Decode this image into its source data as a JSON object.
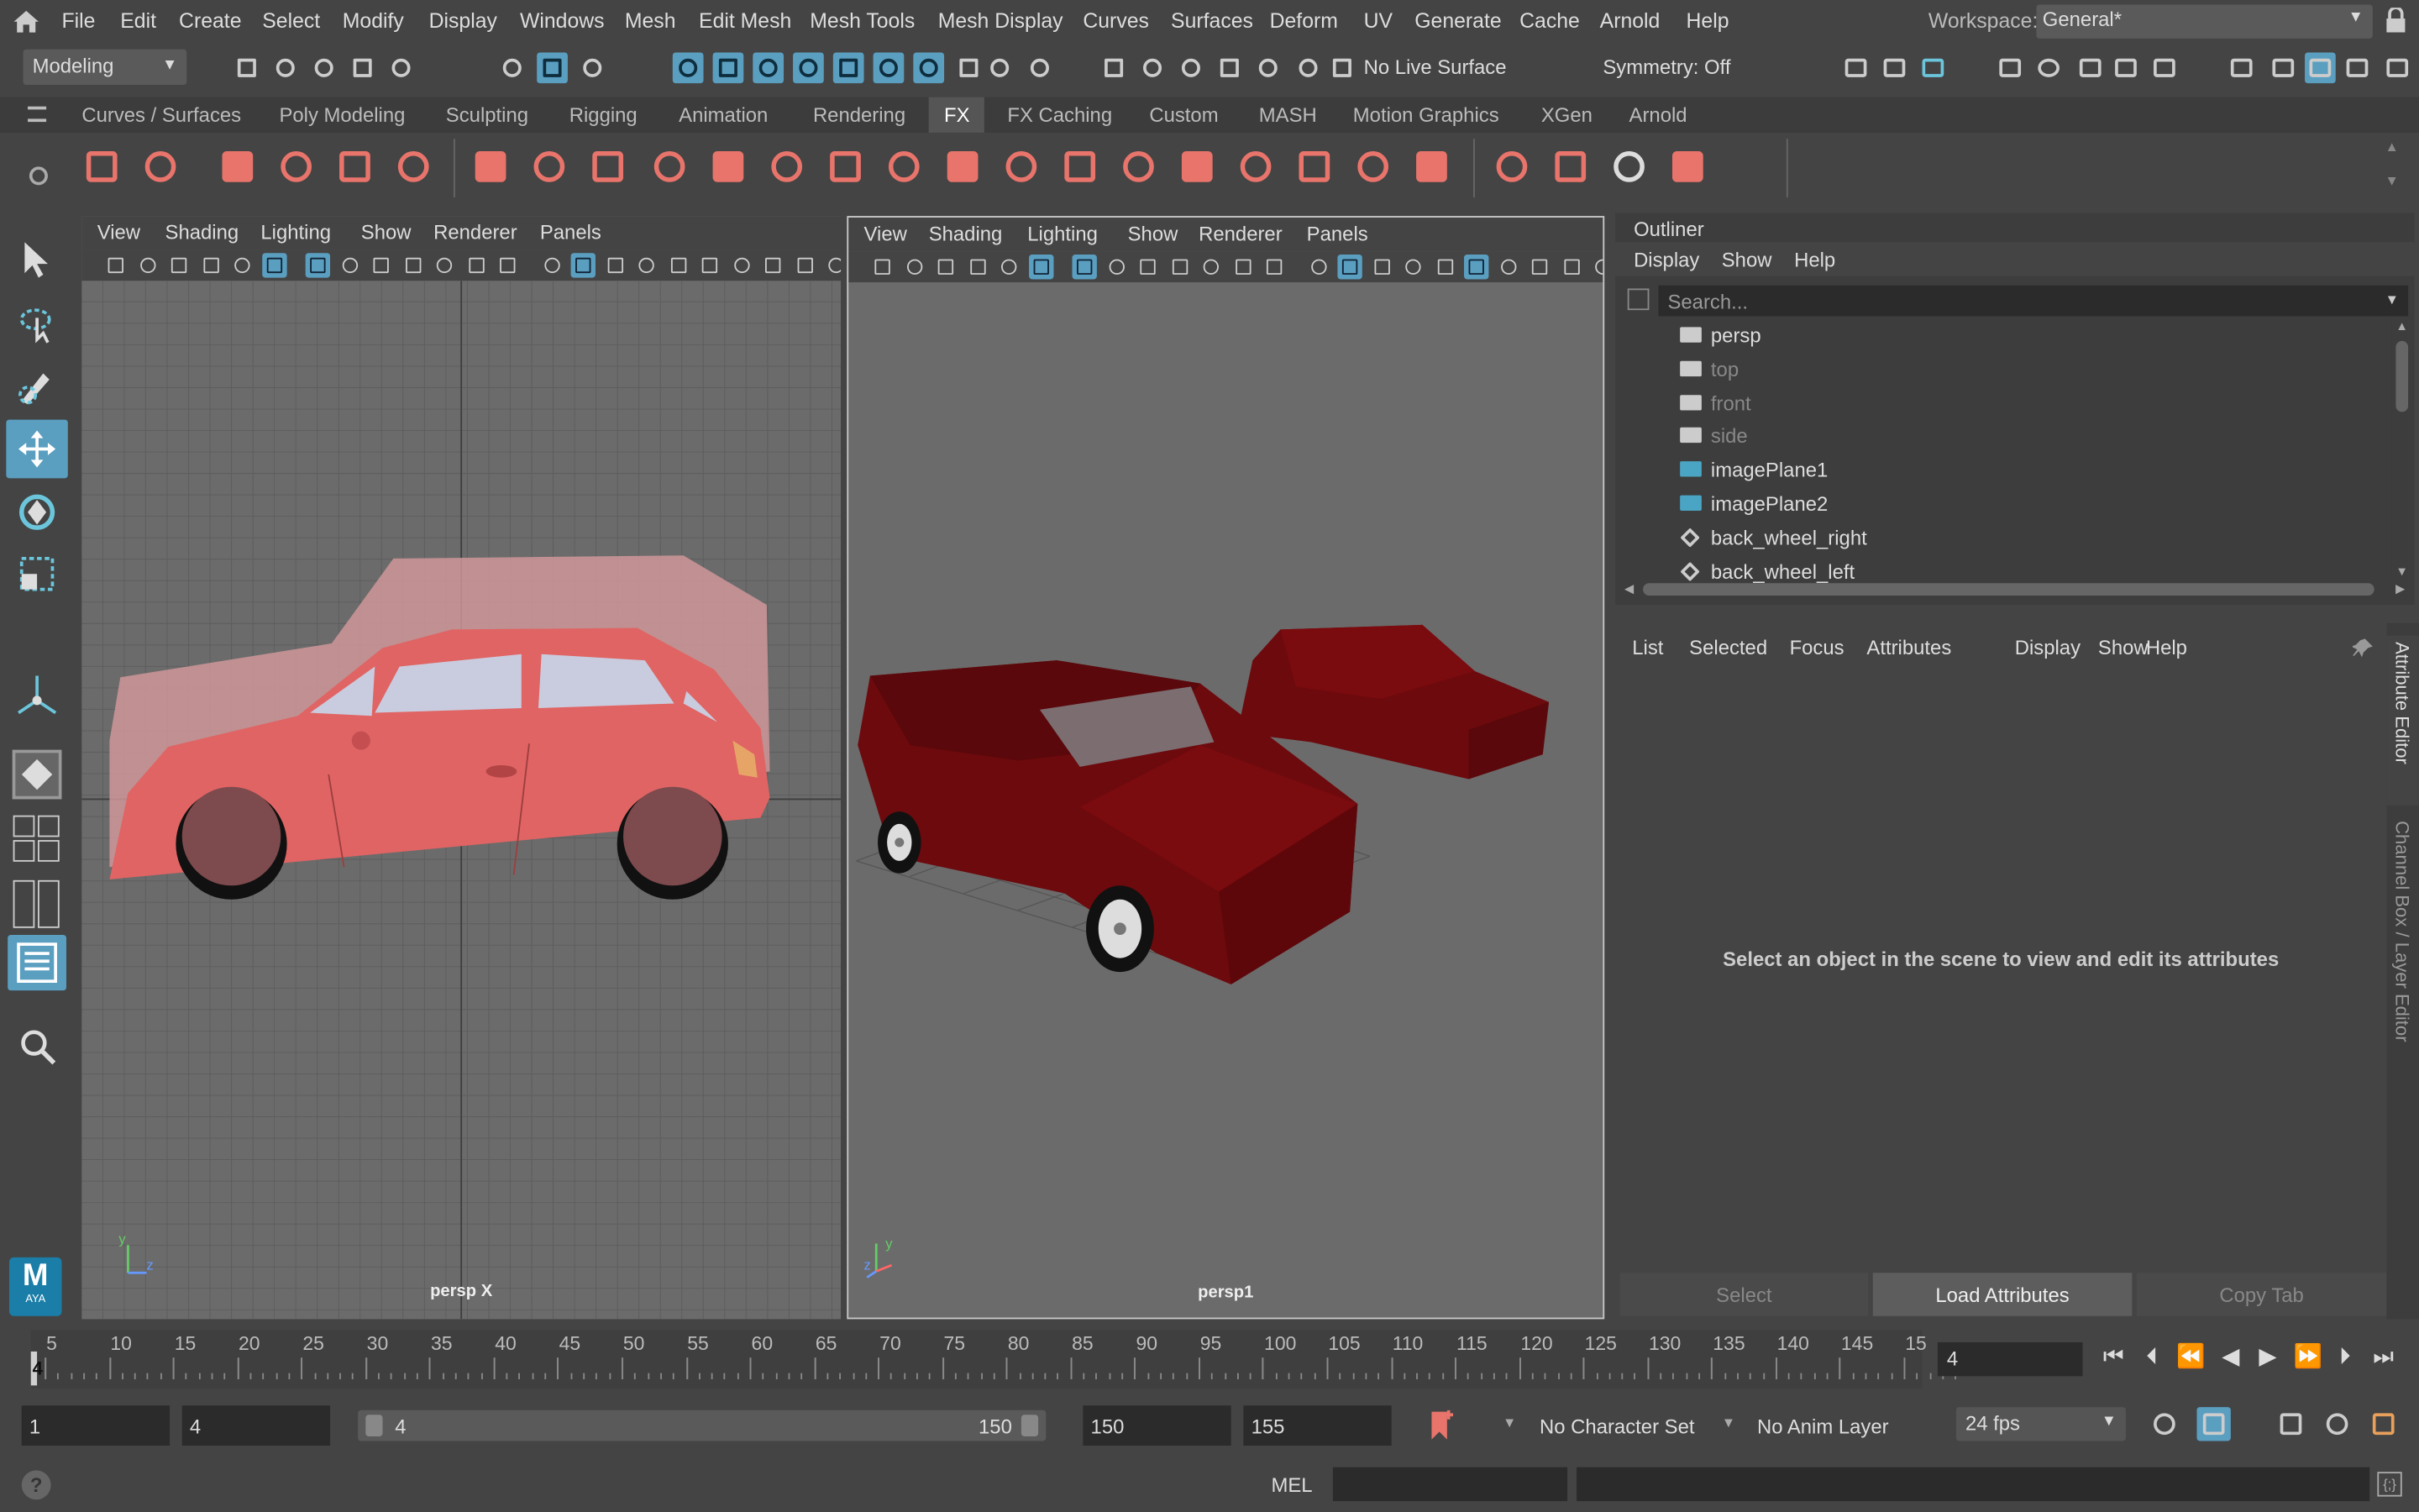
{
  "menubar": {
    "items": [
      "File",
      "Edit",
      "Create",
      "Select",
      "Modify",
      "Display",
      "Windows",
      "Mesh",
      "Edit Mesh",
      "Mesh Tools",
      "Mesh Display",
      "Curves",
      "Surfaces",
      "Deform",
      "UV",
      "Generate",
      "Cache",
      "Arnold",
      "Help"
    ],
    "workspace_label": "Workspace:",
    "workspace_value": "General*"
  },
  "statusline": {
    "mode": "Modeling",
    "live_surface": "No Live Surface",
    "symmetry": "Symmetry: Off"
  },
  "shelf": {
    "tabs": [
      "Curves / Surfaces",
      "Poly Modeling",
      "Sculpting",
      "Rigging",
      "Animation",
      "Rendering",
      "FX",
      "FX Caching",
      "Custom",
      "MASH",
      "Motion Graphics",
      "XGen",
      "Arnold"
    ],
    "active_tab": "FX",
    "accent": "#e8746b"
  },
  "viewport_left": {
    "menus": [
      "View",
      "Shading",
      "Lighting",
      "Show",
      "Renderer",
      "Panels"
    ],
    "camera_label": "persp X"
  },
  "viewport_right": {
    "menus": [
      "View",
      "Shading",
      "Lighting",
      "Show",
      "Renderer",
      "Panels"
    ],
    "camera_label": "persp1"
  },
  "outliner": {
    "title": "Outliner",
    "menus": [
      "Display",
      "Show",
      "Help"
    ],
    "search_placeholder": "Search...",
    "items": [
      {
        "label": "persp",
        "dim": false,
        "icon": "camera-icon"
      },
      {
        "label": "top",
        "dim": true,
        "icon": "camera-icon"
      },
      {
        "label": "front",
        "dim": true,
        "icon": "camera-icon"
      },
      {
        "label": "side",
        "dim": true,
        "icon": "camera-icon"
      },
      {
        "label": "imagePlane1",
        "dim": false,
        "icon": "image-plane-icon"
      },
      {
        "label": "imagePlane2",
        "dim": false,
        "icon": "image-plane-icon"
      },
      {
        "label": "back_wheel_right",
        "dim": false,
        "icon": "mesh-icon"
      },
      {
        "label": "back_wheel_left",
        "dim": false,
        "icon": "mesh-icon"
      }
    ]
  },
  "attribute_editor": {
    "menus": [
      "List",
      "Selected",
      "Focus",
      "Attributes",
      "Display",
      "Show",
      "Help"
    ],
    "message": "Select an object in the scene to view and edit its attributes",
    "buttons": [
      "Select",
      "Load Attributes",
      "Copy Tab"
    ],
    "side_tabs": [
      "Attribute Editor",
      "Channel Box / Layer Editor"
    ]
  },
  "timeline": {
    "ticks": [
      "5",
      "10",
      "15",
      "20",
      "25",
      "30",
      "35",
      "40",
      "45",
      "50",
      "55",
      "60",
      "65",
      "70",
      "75",
      "80",
      "85",
      "90",
      "95",
      "100",
      "105",
      "110",
      "115",
      "120",
      "125",
      "130",
      "135",
      "140",
      "145",
      "15"
    ],
    "current_frame_marker": "4",
    "current_frame_field": "4"
  },
  "range": {
    "start": "1",
    "playback_start": "4",
    "slider_left": "4",
    "slider_right": "150",
    "playback_end": "150",
    "end": "155",
    "character_set": "No Character Set",
    "anim_layer": "No Anim Layer",
    "fps": "24 fps"
  },
  "cmdline": {
    "language": "MEL"
  },
  "logo": {
    "letter": "M",
    "sub": "AYA"
  }
}
